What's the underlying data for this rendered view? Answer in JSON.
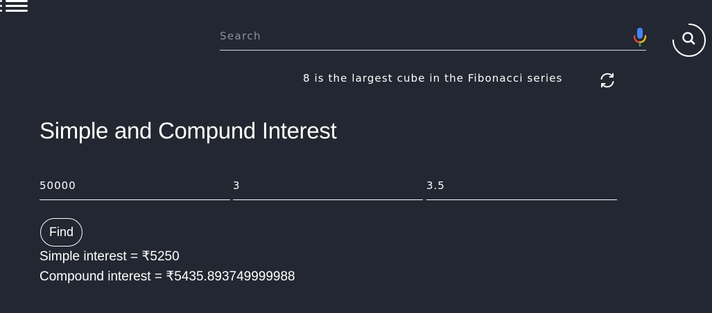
{
  "search": {
    "placeholder": "Search",
    "value": ""
  },
  "fact": {
    "text": "8 is the largest cube in the Fibonacci series"
  },
  "page": {
    "title": "Simple and Compund Interest"
  },
  "form": {
    "principal": "50000",
    "time": "3",
    "rate": "3.5",
    "find_label": "Find"
  },
  "results": {
    "simple": "Simple interest = ₹5250",
    "compound": "Compound interest = ₹5435.893749999988"
  },
  "icons": {
    "menu": "hamburger-menu-icon",
    "mic": "microphone-icon",
    "search": "search-icon",
    "refresh": "refresh-icon"
  },
  "colors": {
    "background": "#222732",
    "text": "#ffffff",
    "placeholder": "#8c909a",
    "mic_blue": "#4285f4",
    "mic_red": "#ea4335",
    "mic_yellow": "#fbbc05",
    "mic_green": "#34a853"
  }
}
